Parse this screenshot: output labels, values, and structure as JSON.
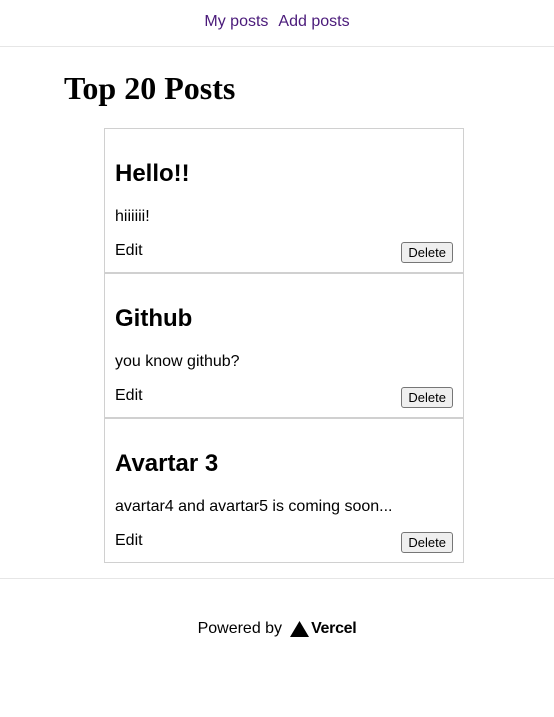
{
  "nav": {
    "links": [
      "My posts",
      "Add posts"
    ]
  },
  "page": {
    "title": "Top 20 Posts"
  },
  "posts": [
    {
      "title": "Hello!!",
      "body": "hiiiiii!",
      "edit_label": "Edit",
      "delete_label": "Delete"
    },
    {
      "title": "Github",
      "body": "you know github?",
      "edit_label": "Edit",
      "delete_label": "Delete"
    },
    {
      "title": "Avartar 3",
      "body": "avartar4 and avartar5 is coming soon...",
      "edit_label": "Edit",
      "delete_label": "Delete"
    }
  ],
  "footer": {
    "powered_by": "Powered by",
    "brand": "Vercel"
  },
  "colors": {
    "nav_link": "#4a1a7a",
    "border": "#d0d0d0"
  },
  "icons": {
    "vercel": "vercel-triangle-icon"
  }
}
